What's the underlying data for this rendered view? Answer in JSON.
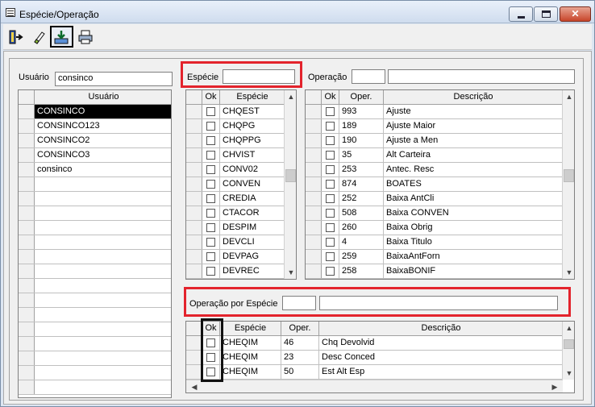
{
  "window": {
    "title": "Espécie/Operação",
    "close_glyph": "✕"
  },
  "toolbar": {
    "buttons": [
      {
        "icon": "exit-door-icon"
      },
      {
        "icon": "eraser-icon"
      },
      {
        "icon": "import-tray-icon",
        "selected": true
      },
      {
        "icon": "printer-icon"
      }
    ]
  },
  "usuario": {
    "label": "Usuário",
    "value": "consinco",
    "grid_header": "Usuário",
    "rows": [
      "CONSINCO",
      "CONSINCO123",
      "CONSINCO2",
      "CONSINCO3",
      "consinco"
    ],
    "selected_index": 0
  },
  "especie": {
    "label": "Espécie",
    "value": "",
    "headers": {
      "ok": "Ok",
      "especie": "Espécie"
    },
    "rows": [
      "CHQEST",
      "CHQPG",
      "CHQPPG",
      "CHVIST",
      "CONV02",
      "CONVEN",
      "CREDIA",
      "CTACOR",
      "DESPIM",
      "DEVCLI",
      "DEVPAG",
      "DEVREC"
    ]
  },
  "operacao": {
    "label": "Operação",
    "code_value": "",
    "desc_value": "",
    "headers": {
      "ok": "Ok",
      "oper": "Oper.",
      "descricao": "Descrição"
    },
    "rows": [
      {
        "oper": "993",
        "descricao": "Ajuste"
      },
      {
        "oper": "189",
        "descricao": "Ajuste Maior"
      },
      {
        "oper": "190",
        "descricao": "Ajuste a Men"
      },
      {
        "oper": "35",
        "descricao": "Alt Carteira"
      },
      {
        "oper": "253",
        "descricao": "Antec. Resc"
      },
      {
        "oper": "874",
        "descricao": "BOATES"
      },
      {
        "oper": "252",
        "descricao": "Baixa AntCli"
      },
      {
        "oper": "508",
        "descricao": "Baixa CONVEN"
      },
      {
        "oper": "260",
        "descricao": "Baixa Obrig"
      },
      {
        "oper": "4",
        "descricao": "Baixa Titulo"
      },
      {
        "oper": "259",
        "descricao": "BaixaAntForn"
      },
      {
        "oper": "258",
        "descricao": "BaixaBONIF"
      }
    ]
  },
  "operacao_por_especie": {
    "label": "Operação por Espécie",
    "code_value": "",
    "desc_value": "",
    "headers": {
      "ok": "Ok",
      "especie": "Espécie",
      "oper": "Oper.",
      "descricao": "Descrição"
    },
    "rows": [
      {
        "especie": "CHEQIM",
        "oper": "46",
        "descricao": "Chq Devolvid"
      },
      {
        "especie": "CHEQIM",
        "oper": "23",
        "descricao": "Desc Conced"
      },
      {
        "especie": "CHEQIM",
        "oper": "50",
        "descricao": "Est Alt Esp"
      }
    ]
  },
  "scroll_glyphs": {
    "up": "▲",
    "down": "▼",
    "left": "◀",
    "right": "▶"
  }
}
